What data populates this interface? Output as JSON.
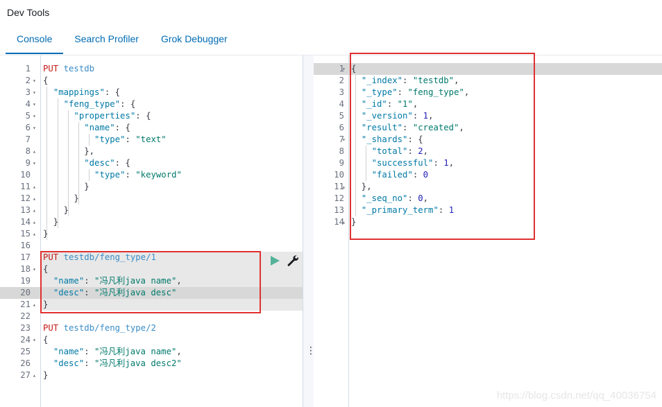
{
  "app": {
    "title": "Dev Tools"
  },
  "tabs": [
    {
      "label": "Console",
      "active": true
    },
    {
      "label": "Search Profiler",
      "active": false
    },
    {
      "label": "Grok Debugger",
      "active": false
    }
  ],
  "request_editor": {
    "lines": [
      "PUT testdb",
      "{",
      "  \"mappings\": {",
      "    \"feng_type\": {",
      "      \"properties\": {",
      "        \"name\": {",
      "          \"type\": \"text\"",
      "        },",
      "        \"desc\": {",
      "          \"type\": \"keyword\"",
      "        }",
      "      }",
      "    }",
      "  }",
      "}",
      "",
      "PUT testdb/feng_type/1",
      "{",
      "  \"name\": \"冯凡利java name\",",
      "  \"desc\": \"冯凡利java desc\"",
      "}",
      "",
      "PUT testdb/feng_type/2",
      "{",
      "  \"name\": \"冯凡利java name\",",
      "  \"desc\": \"冯凡利java desc2\"",
      "}"
    ]
  },
  "response_viewer": {
    "lines": [
      "{",
      "  \"_index\": \"testdb\",",
      "  \"_type\": \"feng_type\",",
      "  \"_id\": \"1\",",
      "  \"_version\": 1,",
      "  \"result\": \"created\",",
      "  \"_shards\": {",
      "    \"total\": 2,",
      "    \"successful\": 1,",
      "    \"failed\": 0",
      "  },",
      "  \"_seq_no\": 0,",
      "  \"_primary_term\": 1",
      "}"
    ]
  },
  "icons": {
    "run": "play-icon",
    "settings": "wrench-icon",
    "resize": "vertical-dots-icon"
  },
  "colors": {
    "accent": "#006bb4",
    "annotation": "#e03030",
    "run": "#54b399"
  },
  "watermark": "https://blog.csdn.net/qq_40036754"
}
